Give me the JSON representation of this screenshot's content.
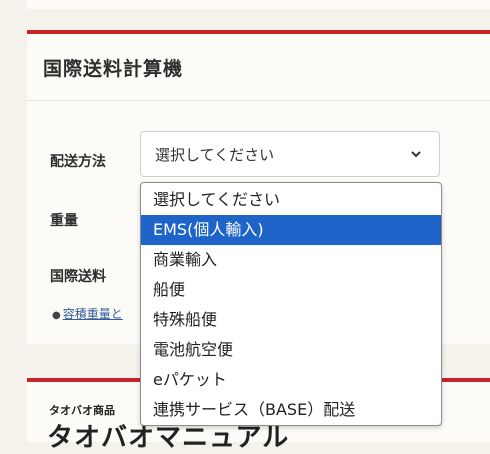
{
  "calculator": {
    "title": "国際送料計算機",
    "shipping_method_label": "配送方法",
    "shipping_method_value": "選択してください",
    "weight_label": "重量",
    "intl_shipping_label": "国際送料",
    "hint_link": "容積重量と"
  },
  "dropdown": {
    "options": [
      "選択してください",
      "EMS(個人輸入)",
      "商業輸入",
      "船便",
      "特殊船便",
      "電池航空便",
      "eパケット",
      "連携サービス（BASE）配送"
    ],
    "highlighted_index": 1
  },
  "next_section": {
    "small_label": "タオバオ商品",
    "big_title": "タオバオマニュアル"
  },
  "colors": {
    "accent": "#c4262a",
    "highlight": "#1e64c8"
  }
}
